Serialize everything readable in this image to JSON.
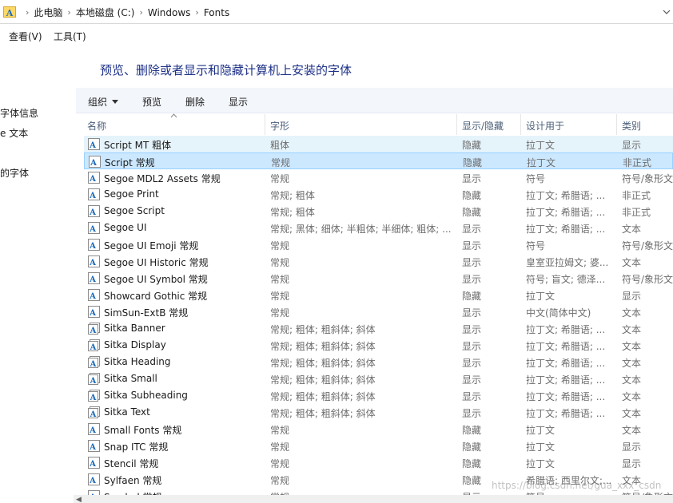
{
  "address": {
    "crumbs": [
      "此电脑",
      "本地磁盘 (C:)",
      "Windows",
      "Fonts"
    ],
    "separator": "›"
  },
  "menu": {
    "view": "查看(V)",
    "tools": "工具(T)"
  },
  "nav": {
    "items": [
      "字体信息",
      "e 文本",
      "的字体"
    ]
  },
  "page_title": "预览、删除或者显示和隐藏计算机上安装的字体",
  "toolbar": {
    "organize": "组织",
    "preview": "预览",
    "delete": "删除",
    "show": "显示"
  },
  "columns": {
    "name": "名称",
    "style": "字形",
    "show_hide": "显示/隐藏",
    "designed_for": "设计用于",
    "category": "类别"
  },
  "rows": [
    {
      "name": "Script MT 粗体",
      "style": "粗体",
      "show": "隐藏",
      "design": "拉丁文",
      "category": "显示",
      "icon": "single-font-icon",
      "state": "hover"
    },
    {
      "name": "Script 常规",
      "style": "常规",
      "show": "隐藏",
      "design": "拉丁文",
      "category": "非正式",
      "icon": "single-font-icon",
      "state": "selected"
    },
    {
      "name": "Segoe MDL2 Assets 常规",
      "style": "常规",
      "show": "显示",
      "design": "符号",
      "category": "符号/象形文",
      "icon": "single-font-icon",
      "state": ""
    },
    {
      "name": "Segoe Print",
      "style": "常规; 粗体",
      "show": "隐藏",
      "design": "拉丁文; 希腊语; ...",
      "category": "非正式",
      "icon": "single-font-icon",
      "state": ""
    },
    {
      "name": "Segoe Script",
      "style": "常规; 粗体",
      "show": "隐藏",
      "design": "拉丁文; 希腊语; ...",
      "category": "非正式",
      "icon": "single-font-icon",
      "state": ""
    },
    {
      "name": "Segoe UI",
      "style": "常规; 黑体; 细体; 半粗体; 半细体; 粗体; ...",
      "show": "显示",
      "design": "拉丁文; 希腊语; ...",
      "category": "文本",
      "icon": "single-font-icon",
      "state": ""
    },
    {
      "name": "Segoe UI Emoji 常规",
      "style": "常规",
      "show": "显示",
      "design": "符号",
      "category": "符号/象形文",
      "icon": "single-font-icon",
      "state": ""
    },
    {
      "name": "Segoe UI Historic 常规",
      "style": "常规",
      "show": "显示",
      "design": "皇室亚拉姆文; 婆...",
      "category": "文本",
      "icon": "single-font-icon",
      "state": ""
    },
    {
      "name": "Segoe UI Symbol 常规",
      "style": "常规",
      "show": "显示",
      "design": "符号; 盲文; 德泽...",
      "category": "符号/象形文",
      "icon": "single-font-icon",
      "state": ""
    },
    {
      "name": "Showcard Gothic 常规",
      "style": "常规",
      "show": "隐藏",
      "design": "拉丁文",
      "category": "显示",
      "icon": "single-font-icon",
      "state": ""
    },
    {
      "name": "SimSun-ExtB 常规",
      "style": "常规",
      "show": "显示",
      "design": "中文(简体中文)",
      "category": "文本",
      "icon": "single-font-icon",
      "state": ""
    },
    {
      "name": "Sitka Banner",
      "style": "常规; 粗体; 粗斜体; 斜体",
      "show": "显示",
      "design": "拉丁文; 希腊语; ...",
      "category": "文本",
      "icon": "font-family-icon",
      "state": ""
    },
    {
      "name": "Sitka Display",
      "style": "常规; 粗体; 粗斜体; 斜体",
      "show": "显示",
      "design": "拉丁文; 希腊语; ...",
      "category": "文本",
      "icon": "font-family-icon",
      "state": ""
    },
    {
      "name": "Sitka Heading",
      "style": "常规; 粗体; 粗斜体; 斜体",
      "show": "显示",
      "design": "拉丁文; 希腊语; ...",
      "category": "文本",
      "icon": "font-family-icon",
      "state": ""
    },
    {
      "name": "Sitka Small",
      "style": "常规; 粗体; 粗斜体; 斜体",
      "show": "显示",
      "design": "拉丁文; 希腊语; ...",
      "category": "文本",
      "icon": "font-family-icon",
      "state": ""
    },
    {
      "name": "Sitka Subheading",
      "style": "常规; 粗体; 粗斜体; 斜体",
      "show": "显示",
      "design": "拉丁文; 希腊语; ...",
      "category": "文本",
      "icon": "font-family-icon",
      "state": ""
    },
    {
      "name": "Sitka Text",
      "style": "常规; 粗体; 粗斜体; 斜体",
      "show": "显示",
      "design": "拉丁文; 希腊语; ...",
      "category": "文本",
      "icon": "font-family-icon",
      "state": ""
    },
    {
      "name": "Small Fonts 常规",
      "style": "常规",
      "show": "隐藏",
      "design": "拉丁文",
      "category": "文本",
      "icon": "single-font-icon",
      "state": ""
    },
    {
      "name": "Snap ITC 常规",
      "style": "常规",
      "show": "隐藏",
      "design": "拉丁文",
      "category": "显示",
      "icon": "single-font-icon",
      "state": ""
    },
    {
      "name": "Stencil 常规",
      "style": "常规",
      "show": "隐藏",
      "design": "拉丁文",
      "category": "显示",
      "icon": "single-font-icon",
      "state": ""
    },
    {
      "name": "Sylfaen 常规",
      "style": "常规",
      "show": "隐藏",
      "design": "希腊语; 西里尔文;...",
      "category": "文本",
      "icon": "single-font-icon",
      "state": ""
    },
    {
      "name": "Symbol 常规",
      "style": "常规",
      "show": "显示",
      "design": "符号",
      "category": "符号/象形文",
      "icon": "single-font-icon",
      "state": ""
    }
  ],
  "watermark": "https://blog.csdn.net/gua_xxx_csdn"
}
